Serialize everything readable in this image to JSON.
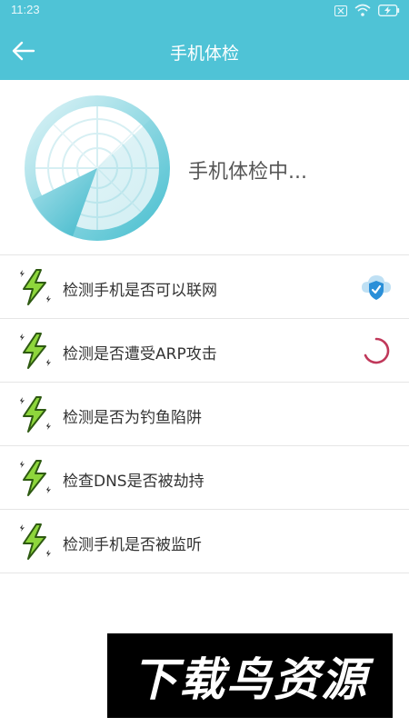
{
  "status_bar": {
    "time": "11:23"
  },
  "app_bar": {
    "title": "手机体检"
  },
  "scan": {
    "status_text": "手机体检中..."
  },
  "checks": [
    {
      "label": "检测手机是否可以联网",
      "state": "passed",
      "icon": "lightning-icon",
      "status_icon": "cloud-shield-check-icon"
    },
    {
      "label": "检测是否遭受ARP攻击",
      "state": "in-progress",
      "icon": "lightning-icon",
      "status_icon": "loading-spinner-icon"
    },
    {
      "label": "检测是否为钓鱼陷阱",
      "state": "pending",
      "icon": "lightning-icon"
    },
    {
      "label": "检查DNS是否被劫持",
      "state": "pending",
      "icon": "lightning-icon"
    },
    {
      "label": "检测手机是否被监听",
      "state": "pending",
      "icon": "lightning-icon"
    }
  ],
  "watermark": {
    "text": "下载鸟资源"
  },
  "colors": {
    "primary": "#4fc3d6",
    "lightning_fill": "#8ed63c",
    "spinner": "#c0385a",
    "shield": "#2b8fd8"
  }
}
